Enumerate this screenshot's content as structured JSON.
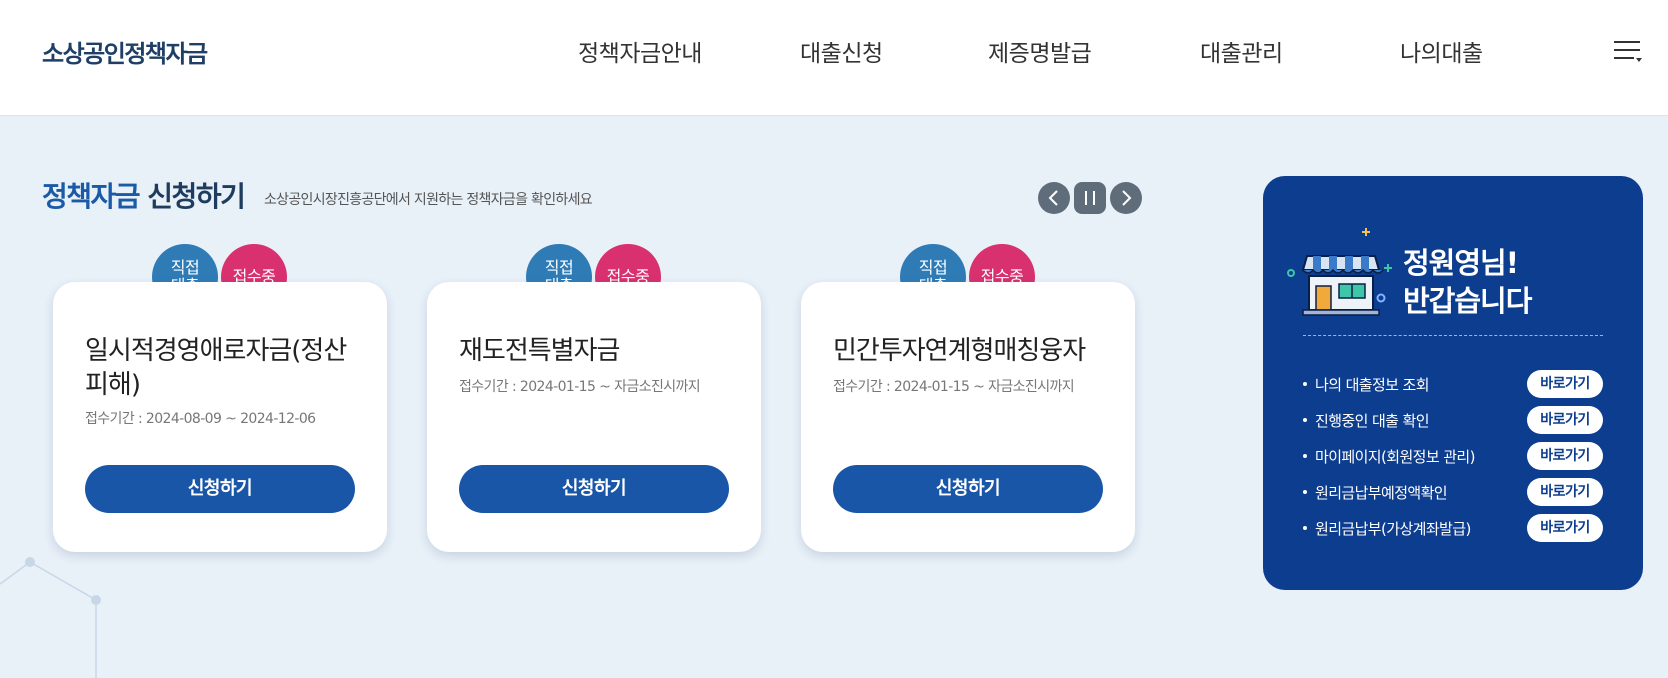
{
  "site": {
    "logo": "소상공인정책자금"
  },
  "nav": {
    "items": [
      {
        "label": "정책자금안내"
      },
      {
        "label": "대출신청"
      },
      {
        "label": "제증명발급"
      },
      {
        "label": "대출관리"
      },
      {
        "label": "나의대출"
      }
    ],
    "menu_icon": "hamburger-menu-icon"
  },
  "section": {
    "title_accent": "정책자금",
    "title_rest": " 신청하기",
    "subtitle": "소상공인시장진흥공단에서 지원하는 정책자금을 확인하세요",
    "controls": {
      "prev_icon": "chevron-left-icon",
      "pause_icon": "pause-icon",
      "next_icon": "chevron-right-icon"
    }
  },
  "cards": [
    {
      "badge_type_line1": "직접",
      "badge_type_line2": "대출",
      "badge_status": "접수중",
      "title": "일시적경영애로자금(정산피해)",
      "period": "접수기간 : 2024-08-09 ~ 2024-12-06",
      "button": "신청하기"
    },
    {
      "badge_type_line1": "직접",
      "badge_type_line2": "대출",
      "badge_status": "접수중",
      "title": "재도전특별자금",
      "period": "접수기간 : 2024-01-15 ~ 자금소진시까지",
      "button": "신청하기"
    },
    {
      "badge_type_line1": "직접",
      "badge_type_line2": "대출",
      "badge_status": "접수중",
      "title": "민간투자연계형매칭융자",
      "period": "접수기간 : 2024-01-15 ~ 자금소진시까지",
      "button": "신청하기"
    }
  ],
  "user_panel": {
    "greeting_line1": "정원영님!",
    "greeting_line2": "반갑습니다",
    "icon": "store-icon",
    "links": [
      {
        "label": "나의 대출정보 조회",
        "button": "바로가기"
      },
      {
        "label": "진행중인 대출 확인",
        "button": "바로가기"
      },
      {
        "label": "마이페이지(회원정보 관리)",
        "button": "바로가기"
      },
      {
        "label": "원리금납부예정액확인",
        "button": "바로가기"
      },
      {
        "label": "원리금납부(가상계좌발급)",
        "button": "바로가기"
      }
    ]
  },
  "colors": {
    "primary": "#1a56a8",
    "panel": "#0d3d8f",
    "badge_direct": "#2f7bb6",
    "badge_open": "#d9306f",
    "background": "#e8f0f8"
  }
}
